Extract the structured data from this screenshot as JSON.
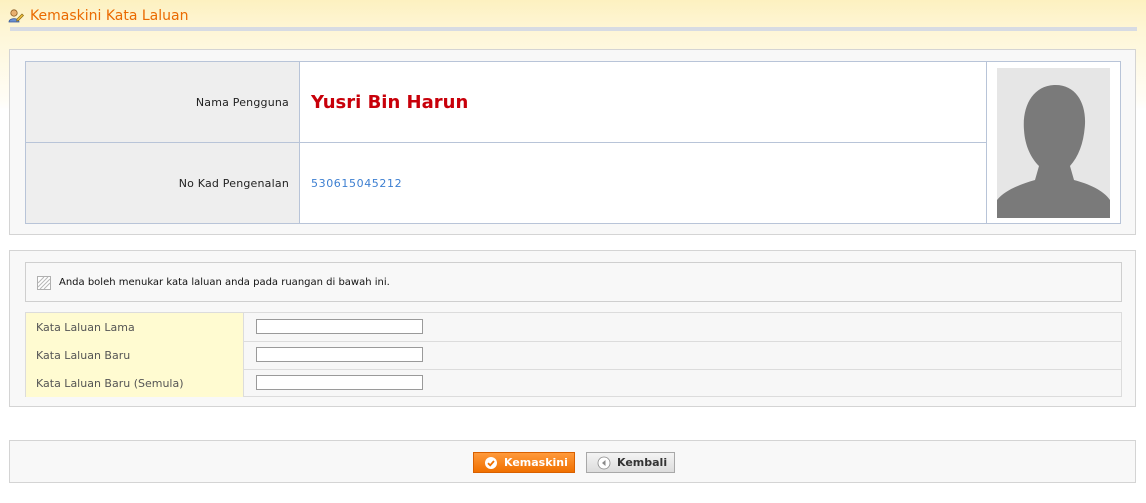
{
  "page": {
    "title": "Kemaskini Kata Laluan"
  },
  "profile": {
    "name_label": "Nama Pengguna",
    "name_value": "Yusri Bin Harun",
    "ic_label": "No Kad Pengenalan",
    "ic_value": "530615045212"
  },
  "notice": {
    "text": "Anda boleh menukar kata laluan anda pada ruangan di bawah ini."
  },
  "form": {
    "old_password_label": "Kata Laluan Lama",
    "new_password_label": "Kata Laluan Baru",
    "confirm_password_label": "Kata Laluan Baru (Semula)",
    "old_password_value": "",
    "new_password_value": "",
    "confirm_password_value": ""
  },
  "actions": {
    "update_label": "Kemaskini",
    "back_label": "Kembali"
  },
  "icons": {
    "page_icon": "user-edit-icon",
    "notice_icon": "notice-stripe-icon",
    "update_icon": "check-circle-icon",
    "back_icon": "back-arrow-icon"
  },
  "colors": {
    "title": "#ea6a00",
    "name": "#c8000a",
    "ic_number": "#3d7fd1",
    "primary_button": "#f07000",
    "label_highlight": "#fffbd1"
  }
}
